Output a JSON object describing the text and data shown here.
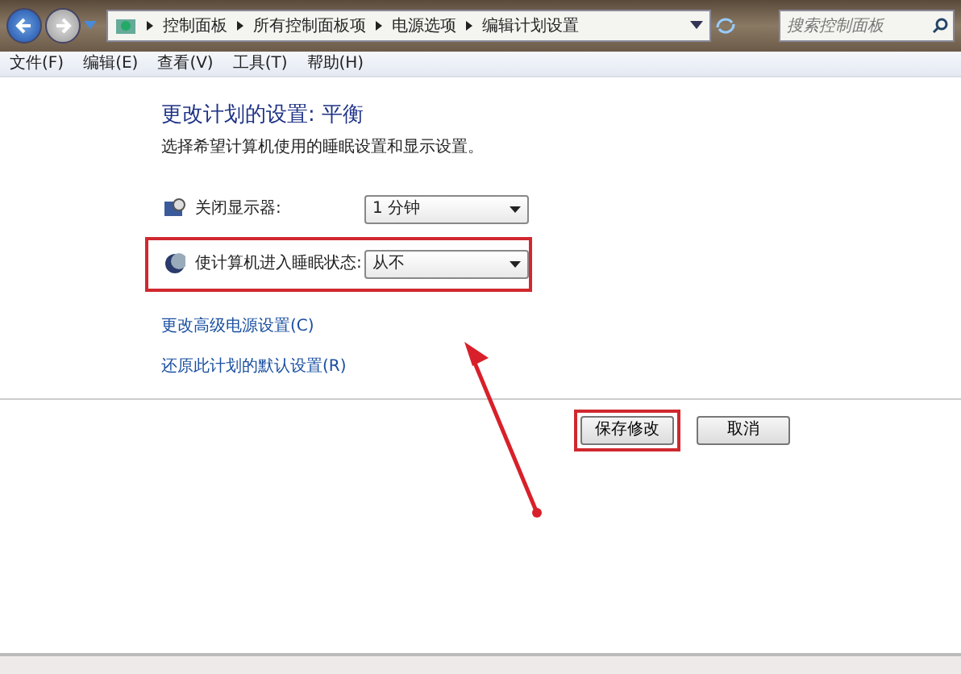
{
  "breadcrumb": [
    "控制面板",
    "所有控制面板项",
    "电源选项",
    "编辑计划设置"
  ],
  "search": {
    "placeholder": "搜索控制面板"
  },
  "menu": [
    "文件(F)",
    "编辑(E)",
    "查看(V)",
    "工具(T)",
    "帮助(H)"
  ],
  "heading": "更改计划的设置: 平衡",
  "description": "选择希望计算机使用的睡眠设置和显示设置。",
  "settings": [
    {
      "kind": "display",
      "label": "关闭显示器:",
      "value": "1 分钟",
      "highlighted": false
    },
    {
      "kind": "sleep",
      "label": "使计算机进入睡眠状态:",
      "value": "从不",
      "highlighted": true
    }
  ],
  "links": [
    "更改高级电源设置(C)",
    "还原此计划的默认设置(R)"
  ],
  "buttons": [
    {
      "label": "保存修改",
      "highlighted": true
    },
    {
      "label": "取消",
      "highlighted": false
    }
  ]
}
